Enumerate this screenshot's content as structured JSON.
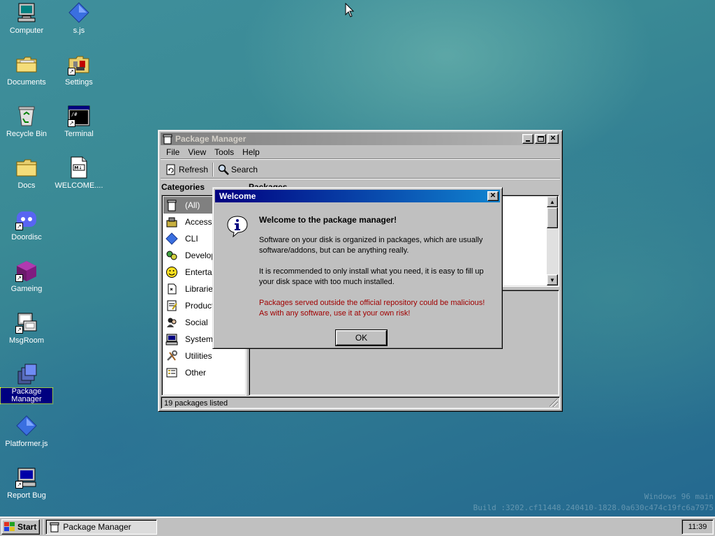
{
  "desktop": {
    "icons": [
      {
        "label": "Computer",
        "icon": "computer-icon"
      },
      {
        "label": "s.js",
        "icon": "diamond-icon"
      },
      {
        "label": "Documents",
        "icon": "folder-icon"
      },
      {
        "label": "Settings",
        "icon": "settings-icon"
      },
      {
        "label": "Recycle Bin",
        "icon": "recycle-bin-icon"
      },
      {
        "label": "Terminal",
        "icon": "terminal-icon"
      },
      {
        "label": "Docs",
        "icon": "folder-icon"
      },
      {
        "label": "WELCOME....",
        "icon": "markdown-file-icon"
      },
      {
        "label": "Doordisc",
        "icon": "doordisc-icon"
      },
      {
        "label": "Gameing",
        "icon": "cube-icon"
      },
      {
        "label": "MsgRoom",
        "icon": "msgroom-icon"
      },
      {
        "label": "Package Manager",
        "icon": "package-manager-icon"
      },
      {
        "label": "Platformer.js",
        "icon": "diamond-icon"
      },
      {
        "label": "Report Bug",
        "icon": "report-bug-icon"
      }
    ],
    "watermark_line1": "Windows 96 main",
    "watermark_line2": "Build :3202.cf11448.240410-1828.0a630c474c19fc6a7975"
  },
  "pm_window": {
    "title": "Package Manager",
    "menu": [
      "File",
      "View",
      "Tools",
      "Help"
    ],
    "toolbar": {
      "refresh": "Refresh",
      "search": "Search"
    },
    "categories_header": "Categories",
    "packages_header": "Packages",
    "categories": [
      {
        "label": "(All)",
        "icon": "all-packages-icon",
        "selected": true
      },
      {
        "label": "Accessories",
        "icon": "accessories-icon"
      },
      {
        "label": "CLI",
        "icon": "cli-icon"
      },
      {
        "label": "Development",
        "icon": "development-icon"
      },
      {
        "label": "Entertainment",
        "icon": "entertainment-icon"
      },
      {
        "label": "Libraries",
        "icon": "libraries-icon"
      },
      {
        "label": "Productivity",
        "icon": "productivity-icon"
      },
      {
        "label": "Social",
        "icon": "social-icon"
      },
      {
        "label": "System",
        "icon": "system-icon"
      },
      {
        "label": "Utilities",
        "icon": "utilities-icon"
      },
      {
        "label": "Other",
        "icon": "other-icon"
      }
    ],
    "status": "19 packages listed"
  },
  "dialog": {
    "title": "Welcome",
    "heading": "Welcome to the package manager!",
    "para1": "Software on your disk is organized in packages, which are usually software/addons, but can be anything really.",
    "para2": "It is recommended to only install what you need, it is easy to fill up your disk space with too much installed.",
    "warning": "Packages served outside the official repository could be malicious! As with any software, use it at your own risk!",
    "ok": "OK",
    "close": "×",
    "warning_color": "#a00000"
  },
  "taskbar": {
    "start": "Start",
    "task": "Package Manager",
    "clock": "11:39"
  }
}
